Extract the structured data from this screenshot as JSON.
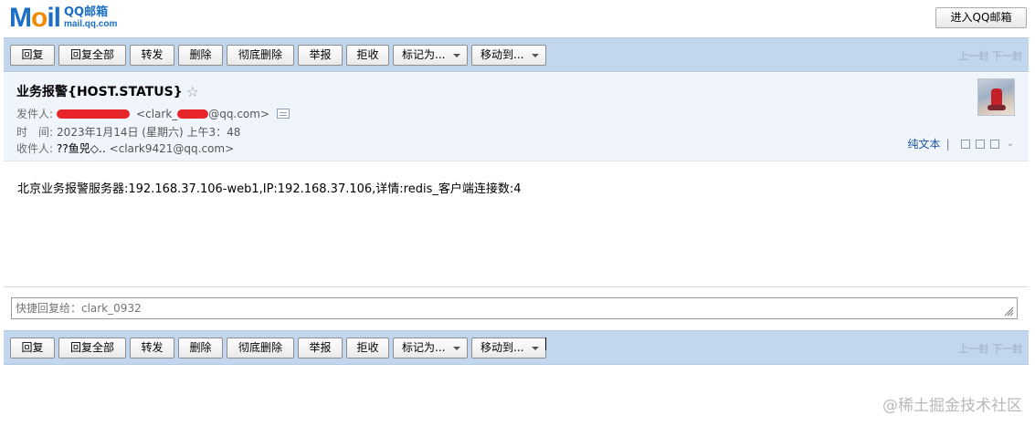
{
  "header": {
    "logo_word_m": "M",
    "logo_word_o": "o",
    "logo_word_il": "il",
    "logo_cn": "QQ邮箱",
    "logo_domain": "mail.qq.com",
    "enter_button": "进入QQ邮箱"
  },
  "toolbar": {
    "reply": "回复",
    "reply_all": "回复全部",
    "forward": "转发",
    "delete": "删除",
    "delete_perm": "彻底删除",
    "report": "举报",
    "reject": "拒收",
    "mark_as": "标记为...",
    "move_to": "移动到...",
    "prev": "上一封",
    "next": "下一封"
  },
  "message": {
    "subject": "业务报警{HOST.STATUS}",
    "star_glyph": "☆",
    "from_label": "发件人:",
    "from_addr_prefix": "<clark_",
    "from_addr_suffix": "@qq.com>",
    "time_label": "时　间:",
    "time_value": "2023年1月14日 (星期六) 上午3：48",
    "to_label": "收件人:",
    "to_name": "??鱼兕◇..",
    "to_addr": "<clark9421@qq.com>",
    "plain_text": "纯文本",
    "separator": "|",
    "chevron": "⌄",
    "body": "北京业务报警服务器:192.168.37.106-web1,IP:192.168.37.106,详情:redis_客户端连接数:4"
  },
  "quick_reply": {
    "placeholder": "快捷回复给：clark_0932"
  },
  "watermark": "@稀土掘金技术社区"
}
